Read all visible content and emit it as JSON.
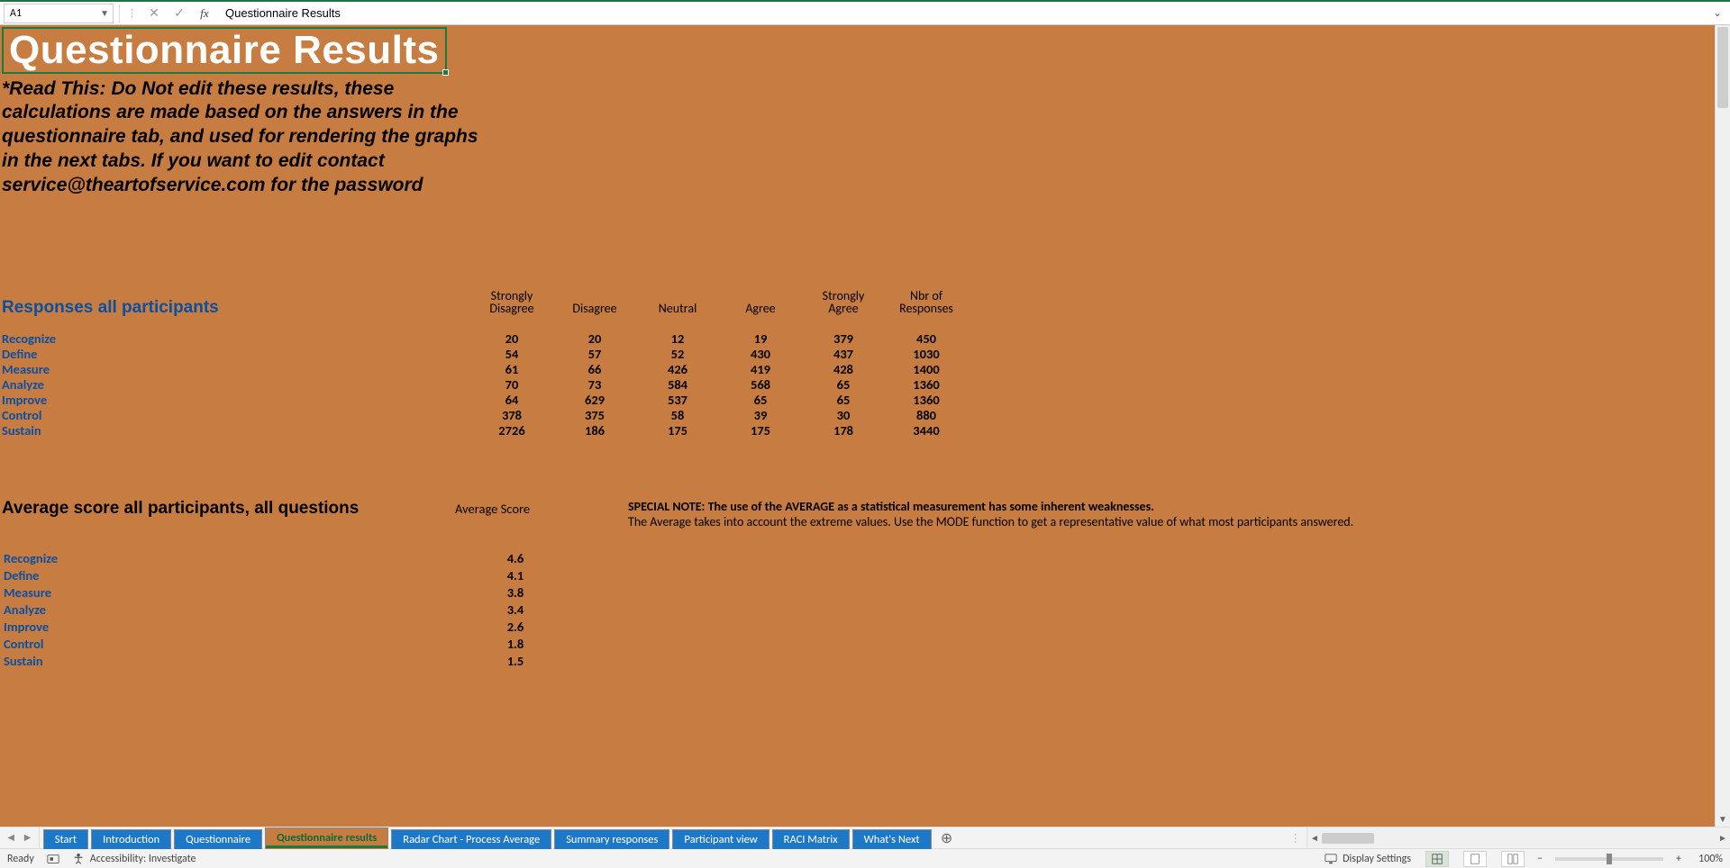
{
  "formula_bar": {
    "cell_ref": "A1",
    "cancel_glyph": "✕",
    "confirm_glyph": "✓",
    "fx_label": "fx",
    "formula_value": "Questionnaire Results"
  },
  "content": {
    "title": "Questionnaire Results",
    "warning": "*Read This: Do Not edit these results, these calculations are made based on the answers in the questionnaire tab, and used for rendering the graphs in the next tabs. If you want to edit contact service@theartofservice.com for the password",
    "responses": {
      "heading": "Responses all participants",
      "columns": [
        "Strongly Disagree",
        "Disagree",
        "Neutral",
        "Agree",
        "Strongly Agree",
        "Nbr of Responses"
      ],
      "rows": [
        {
          "label": "Recognize",
          "values": [
            "20",
            "20",
            "12",
            "19",
            "379",
            "450"
          ]
        },
        {
          "label": "Define",
          "values": [
            "54",
            "57",
            "52",
            "430",
            "437",
            "1030"
          ]
        },
        {
          "label": "Measure",
          "values": [
            "61",
            "66",
            "426",
            "419",
            "428",
            "1400"
          ]
        },
        {
          "label": "Analyze",
          "values": [
            "70",
            "73",
            "584",
            "568",
            "65",
            "1360"
          ]
        },
        {
          "label": "Improve",
          "values": [
            "64",
            "629",
            "537",
            "65",
            "65",
            "1360"
          ]
        },
        {
          "label": "Control",
          "values": [
            "378",
            "375",
            "58",
            "39",
            "30",
            "880"
          ]
        },
        {
          "label": "Sustain",
          "values": [
            "2726",
            "186",
            "175",
            "175",
            "178",
            "3440"
          ]
        }
      ]
    },
    "averages": {
      "heading": "Average score all participants, all questions",
      "col_head": "Average Score",
      "note_bold": "SPECIAL NOTE: The use of the AVERAGE as a statistical measurement has some inherent weaknesses.",
      "note_line": "The Average takes into account the extreme values. Use the MODE function to get a representative value of what most participants answered.",
      "rows": [
        {
          "label": "Recognize",
          "value": "4.6"
        },
        {
          "label": "Define",
          "value": "4.1"
        },
        {
          "label": "Measure",
          "value": "3.8"
        },
        {
          "label": "Analyze",
          "value": "3.4"
        },
        {
          "label": "Improve",
          "value": "2.6"
        },
        {
          "label": "Control",
          "value": "1.8"
        },
        {
          "label": "Sustain",
          "value": "1.5"
        }
      ]
    }
  },
  "tabs": {
    "items": [
      {
        "label": "Start",
        "active": false
      },
      {
        "label": "Introduction",
        "active": false
      },
      {
        "label": "Questionnaire",
        "active": false
      },
      {
        "label": "Questionnaire results",
        "active": true
      },
      {
        "label": "Radar Chart - Process Average",
        "active": false
      },
      {
        "label": "Summary responses",
        "active": false
      },
      {
        "label": "Participant view",
        "active": false
      },
      {
        "label": "RACI Matrix",
        "active": false
      },
      {
        "label": "What's Next",
        "active": false
      }
    ],
    "add_glyph": "⊕"
  },
  "status": {
    "ready": "Ready",
    "accessibility": "Accessibility: Investigate",
    "display_settings": "Display Settings",
    "zoom_minus": "−",
    "zoom_plus": "+",
    "zoom_pct": "100%"
  }
}
